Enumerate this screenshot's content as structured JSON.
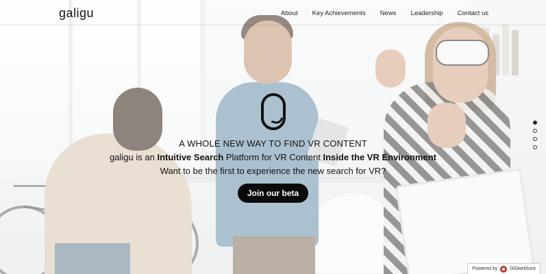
{
  "brand": {
    "logo_text": "galigu"
  },
  "nav": {
    "items": [
      {
        "label": "About"
      },
      {
        "label": "Key Achievements"
      },
      {
        "label": "News"
      },
      {
        "label": "Leadership"
      },
      {
        "label": "Contact us"
      }
    ]
  },
  "hero": {
    "headline": "A WHOLE NEW WAY TO FIND VR CONTENT",
    "tagline_parts": {
      "p1": "galigu is an ",
      "b1": "Intuitive Search",
      "p2": " Platform for VR Content ",
      "b2": "Inside the VR Environment"
    },
    "question": "Want to be the first to experience the new search for VR?",
    "cta_label": "Join our beta"
  },
  "pager": {
    "total": 4,
    "active_index": 0
  },
  "footer_badge": {
    "prefix": "Powered by",
    "name": "000webhost"
  },
  "colors": {
    "text": "#111111",
    "button_bg": "#0a0a0a",
    "button_text": "#ffffff",
    "badge_icon": "#c0392b"
  }
}
